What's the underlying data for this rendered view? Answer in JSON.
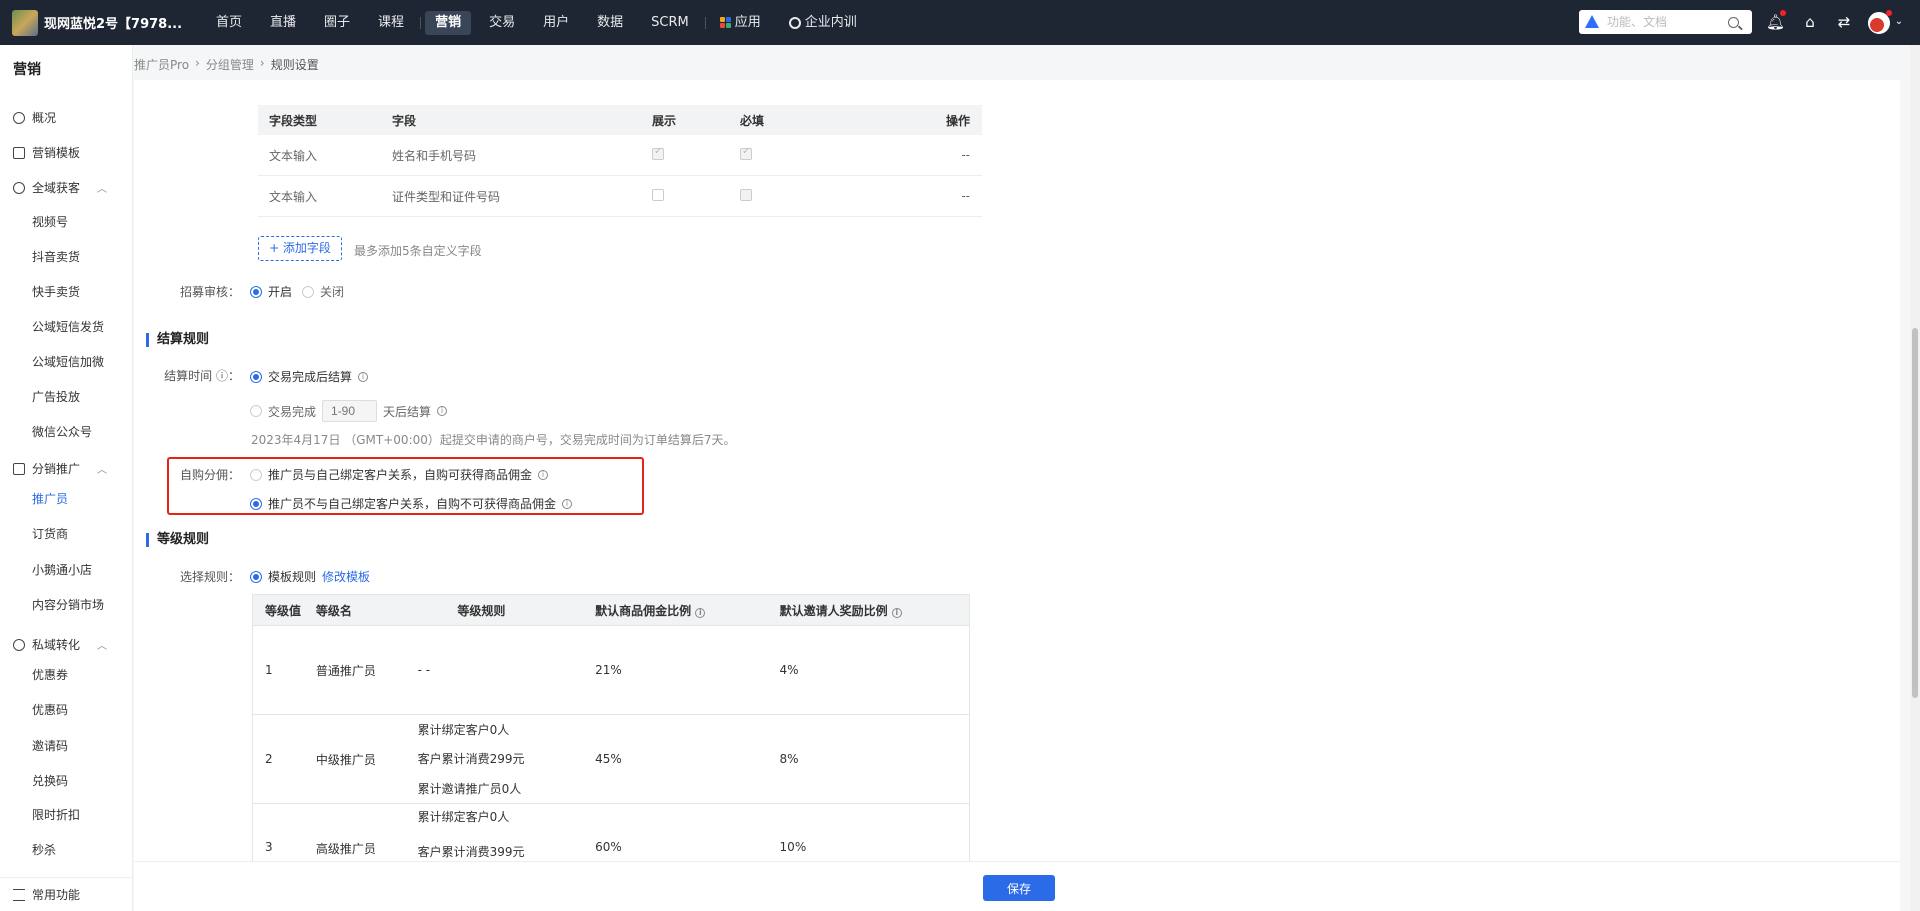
{
  "topbar": {
    "shop_name": "现网蓝悦2号【7978...",
    "nav": [
      "首页",
      "直播",
      "圈子",
      "课程",
      "营销",
      "交易",
      "用户",
      "数据",
      "SCRM",
      "应用",
      "企业内训"
    ],
    "active_nav": "营销",
    "search_placeholder": "功能、文档"
  },
  "sidebar": {
    "title": "营销",
    "items": {
      "overview": "概况",
      "template": "营销模板",
      "acquire": "全域获客",
      "shipinhao": "视频号",
      "douyin": "抖音卖货",
      "kuaishou": "快手卖货",
      "sms_send": "公域短信发货",
      "sms_add": "公域短信加微",
      "ads": "广告投放",
      "wechat_oa": "微信公众号",
      "distribution": "分销推广",
      "promoter": "推广员",
      "order_agent": "订货商",
      "mini_shop": "小鹅通小店",
      "content_market": "内容分销市场",
      "private": "私域转化",
      "coupon": "优惠券",
      "coupon_code": "优惠码",
      "invite_code": "邀请码",
      "redeem_code": "兑换码",
      "limited_discount": "限时折扣",
      "flash_sale": "秒杀",
      "common": "常用功能"
    }
  },
  "breadcrumb": [
    "推广员Pro",
    "分组管理",
    "规则设置"
  ],
  "field_table": {
    "headers": [
      "字段类型",
      "字段",
      "展示",
      "必填",
      "操作"
    ],
    "rows": [
      {
        "type": "文本输入",
        "field": "姓名和手机号码",
        "op": "--"
      },
      {
        "type": "文本输入",
        "field": "证件类型和证件号码",
        "op": "--"
      }
    ],
    "add_button": "+ 添加字段",
    "add_hint": "最多添加5条自定义字段"
  },
  "recruit_review": {
    "label": "招募审核：",
    "on": "开启",
    "off": "关闭"
  },
  "settlement": {
    "section_title": "结算规则",
    "time_label": "结算时间 ⓘ：",
    "opt1": "交易完成后结算",
    "opt2_prefix": "交易完成",
    "opt2_placeholder": "1-90",
    "opt2_suffix": "天后结算",
    "note": "2023年4月17日 （GMT+00:00）起提交申请的商户号，交易完成时间为订单结算后7天。"
  },
  "self_purchase": {
    "label": "自购分佣：",
    "opt1": "推广员与自己绑定客户关系，自购可获得商品佣金",
    "opt2": "推广员不与自己绑定客户关系，自购不可获得商品佣金"
  },
  "level": {
    "section_title": "等级规则",
    "select_label": "选择规则：",
    "template_opt": "模板规则",
    "edit_link": "修改模板",
    "headers": [
      "等级值",
      "等级名",
      "等级规则",
      "默认商品佣金比例",
      "默认邀请人奖励比例"
    ],
    "rows": [
      {
        "value": "1",
        "name": "普通推广员",
        "rules": [
          "- -"
        ],
        "commission": "21%",
        "reward": "4%"
      },
      {
        "value": "2",
        "name": "中级推广员",
        "rules": [
          "累计绑定客户0人",
          "客户累计消费299元",
          "累计邀请推广员0人"
        ],
        "commission": "45%",
        "reward": "8%"
      },
      {
        "value": "3",
        "name": "高级推广员",
        "rules": [
          "累计绑定客户0人",
          "客户累计消费399元"
        ],
        "commission": "60%",
        "reward": "10%"
      }
    ]
  },
  "footer": {
    "save": "保存"
  }
}
